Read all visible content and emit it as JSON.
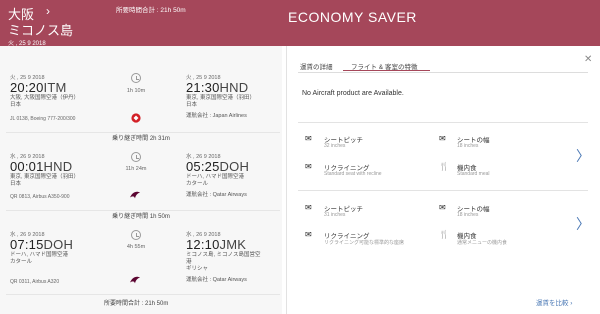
{
  "header": {
    "origin": "大阪",
    "destination": "ミコノス島",
    "date": "火 , 25 9 2018",
    "total_time": "所要時間合計 : 21h 50m",
    "fare_name": "ECONOMY SAVER",
    "chevron": "›"
  },
  "segments": [
    {
      "dep_date": "火 , 25 9 2018",
      "dep_time": "20:20",
      "dep_code": "ITM",
      "dep_city": "大阪, 大阪国際空港（伊丹）",
      "dep_country": "日本",
      "duration": "1h 10m",
      "arr_date": "火 , 25 9 2018",
      "arr_time": "21:30",
      "arr_code": "HND",
      "arr_city": "東京, 東京国際空港（羽田）",
      "arr_country": "日本",
      "operator": "運航会社 : Japan Airlines",
      "flight": "JL 0138, Boeing 777-200/300"
    },
    {
      "dep_date": "水 , 26 9 2018",
      "dep_time": "00:01",
      "dep_code": "HND",
      "dep_city": "東京, 東京国際空港（羽田）",
      "dep_country": "日本",
      "duration": "11h 24m",
      "arr_date": "水 , 26 9 2018",
      "arr_time": "05:25",
      "arr_code": "DOH",
      "arr_city": "ドーハ, ハマド国際空港",
      "arr_country": "カタール",
      "operator": "運航会社 : Qatar Airways",
      "flight": "QR 0813, Airbus A350-900"
    },
    {
      "dep_date": "水 , 26 9 2018",
      "dep_time": "07:15",
      "dep_code": "DOH",
      "dep_city": "ドーハ, ハマド国際空港",
      "dep_country": "カタール",
      "duration": "4h 55m",
      "arr_date": "水 , 26 9 2018",
      "arr_time": "12:10",
      "arr_code": "JMK",
      "arr_city": "ミコノス島, ミコノス島国営空",
      "arr_city2": "港",
      "arr_country": "ギリシャ",
      "operator": "運航会社 : Qatar Airways",
      "flight": "QR 0311, Airbus A320"
    }
  ],
  "layovers": [
    "乗り継ぎ時間 2h 31m",
    "乗り継ぎ時間 1h 50m"
  ],
  "total_bottom": "所要時間合計 : 21h 50m",
  "tabs": {
    "details": "運賃の詳細",
    "features": "フライト & 客室の特徴"
  },
  "no_aircraft": "No Aircraft product are Available.",
  "amenity_groups": [
    {
      "items": [
        {
          "icon": "seat-pitch-icon",
          "title": "シートピッチ",
          "sub": "32 inches"
        },
        {
          "icon": "seat-width-icon",
          "title": "シートの幅",
          "sub": "18 inches"
        },
        {
          "icon": "recline-icon",
          "title": "リクライニング",
          "sub": "Standard seat with recline"
        },
        {
          "icon": "meal-icon",
          "title": "機内食",
          "sub": "Standard meal"
        }
      ]
    },
    {
      "items": [
        {
          "icon": "seat-pitch-icon",
          "title": "シートピッチ",
          "sub": "31 inches"
        },
        {
          "icon": "seat-width-icon",
          "title": "シートの幅",
          "sub": "18 inches"
        },
        {
          "icon": "recline-icon",
          "title": "リクライニング",
          "sub": "リクライニング可能な標準的な座席"
        },
        {
          "icon": "meal-icon",
          "title": "機内食",
          "sub": "通常メニューの機内食"
        }
      ]
    }
  ],
  "compare_link": "運賃を比較 ›",
  "close": "✕",
  "colors": {
    "brand": "#a5475a",
    "link": "#4a78b5"
  }
}
